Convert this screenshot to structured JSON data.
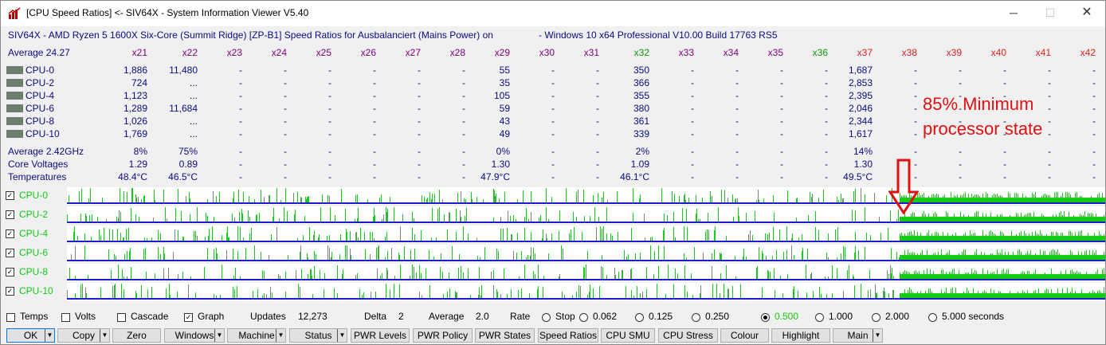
{
  "window": {
    "title": "[CPU Speed Ratios] <- SIV64X - System Information Viewer V5.40",
    "minimize_glyph": "─",
    "maximize_glyph": "☐",
    "close_glyph": "✕"
  },
  "header": {
    "system_line": "SIV64X - AMD Ryzen 5 1600X Six-Core (Summit Ridge) [ZP-B1] Speed Ratios for Ausbalanciert (Mains Power) on",
    "os_line": "- Windows 10 x64 Professional  V10.00  Build 17763  RS5"
  },
  "ratios": {
    "average_label": "Average 24.27",
    "columns": [
      {
        "label": "x21",
        "color": "purple"
      },
      {
        "label": "x22",
        "color": "purple"
      },
      {
        "label": "x23",
        "color": "purple"
      },
      {
        "label": "x24",
        "color": "purple"
      },
      {
        "label": "x25",
        "color": "purple"
      },
      {
        "label": "x26",
        "color": "purple"
      },
      {
        "label": "x27",
        "color": "purple"
      },
      {
        "label": "x28",
        "color": "purple"
      },
      {
        "label": "x29",
        "color": "purple"
      },
      {
        "label": "x30",
        "color": "purple"
      },
      {
        "label": "x31",
        "color": "purple"
      },
      {
        "label": "x32",
        "color": "green"
      },
      {
        "label": "x33",
        "color": "purple"
      },
      {
        "label": "x34",
        "color": "purple"
      },
      {
        "label": "x35",
        "color": "purple"
      },
      {
        "label": "x36",
        "color": "green"
      },
      {
        "label": "x37",
        "color": "red"
      },
      {
        "label": "x38",
        "color": "red"
      },
      {
        "label": "x39",
        "color": "red"
      },
      {
        "label": "x40",
        "color": "red"
      },
      {
        "label": "x41",
        "color": "red"
      },
      {
        "label": "x42",
        "color": "red"
      }
    ],
    "rows": [
      {
        "name": "CPU-0",
        "values": [
          "1,886",
          "11,480",
          "-",
          "-",
          "-",
          "-",
          "-",
          "-",
          "55",
          "-",
          "-",
          "350",
          "-",
          "-",
          "-",
          "-",
          "1,687",
          "-",
          "-",
          "-",
          "-",
          "-"
        ]
      },
      {
        "name": "CPU-2",
        "values": [
          "724",
          "...",
          "-",
          "-",
          "-",
          "-",
          "-",
          "-",
          "35",
          "-",
          "-",
          "366",
          "-",
          "-",
          "-",
          "-",
          "2,853",
          "-",
          "-",
          "-",
          "-",
          "-"
        ]
      },
      {
        "name": "CPU-4",
        "values": [
          "1,123",
          "...",
          "-",
          "-",
          "-",
          "-",
          "-",
          "-",
          "105",
          "-",
          "-",
          "355",
          "-",
          "-",
          "-",
          "-",
          "2,395",
          "-",
          "-",
          "-",
          "-",
          "-"
        ]
      },
      {
        "name": "CPU-6",
        "values": [
          "1,289",
          "11,684",
          "-",
          "-",
          "-",
          "-",
          "-",
          "-",
          "59",
          "-",
          "-",
          "380",
          "-",
          "-",
          "-",
          "-",
          "2,046",
          "-",
          "-",
          "-",
          "-",
          "-"
        ]
      },
      {
        "name": "CPU-8",
        "values": [
          "1,026",
          "...",
          "-",
          "-",
          "-",
          "-",
          "-",
          "-",
          "43",
          "-",
          "-",
          "361",
          "-",
          "-",
          "-",
          "-",
          "2,344",
          "-",
          "-",
          "-",
          "-",
          "-"
        ]
      },
      {
        "name": "CPU-10",
        "values": [
          "1,769",
          "...",
          "-",
          "-",
          "-",
          "-",
          "-",
          "-",
          "49",
          "-",
          "-",
          "339",
          "-",
          "-",
          "-",
          "-",
          "1,617",
          "-",
          "-",
          "-",
          "-",
          "-"
        ]
      }
    ],
    "summary": [
      {
        "name": "Average 2.42GHz",
        "values": [
          "8%",
          "75%",
          "-",
          "-",
          "-",
          "-",
          "-",
          "-",
          "0%",
          "-",
          "-",
          "2%",
          "-",
          "-",
          "-",
          "-",
          "14%",
          "-",
          "-",
          "-",
          "-",
          "-"
        ]
      },
      {
        "name": "Core Voltages",
        "values": [
          "1.29",
          "0.89",
          "-",
          "-",
          "-",
          "-",
          "-",
          "-",
          "1.30",
          "-",
          "-",
          "1.09",
          "-",
          "-",
          "-",
          "-",
          "1.30",
          "-",
          "-",
          "-",
          "-",
          "-"
        ]
      },
      {
        "name": "Temperatures",
        "values": [
          "48.4°C",
          "46.5°C",
          "-",
          "-",
          "-",
          "-",
          "-",
          "-",
          "47.9°C",
          "-",
          "-",
          "46.1°C",
          "-",
          "-",
          "-",
          "-",
          "49.5°C",
          "-",
          "-",
          "-",
          "-",
          "-"
        ]
      }
    ]
  },
  "graphs": [
    {
      "name": "CPU-0",
      "checked": true
    },
    {
      "name": "CPU-2",
      "checked": true
    },
    {
      "name": "CPU-4",
      "checked": true
    },
    {
      "name": "CPU-6",
      "checked": true
    },
    {
      "name": "CPU-8",
      "checked": true
    },
    {
      "name": "CPU-10",
      "checked": true
    }
  ],
  "annotation": {
    "line1": "85% Minimum",
    "line2": "processor state"
  },
  "status": {
    "temps_label": "Temps",
    "temps_checked": false,
    "volts_label": "Volts",
    "volts_checked": false,
    "cascade_label": "Cascade",
    "cascade_checked": false,
    "graph_label": "Graph",
    "graph_checked": true,
    "updates_label": "Updates",
    "updates_value": "12,273",
    "delta_label": "Delta",
    "delta_value": "2",
    "average_label": "Average",
    "average_value": "2.0",
    "rate_label": "Rate",
    "rates": [
      {
        "label": "Stop",
        "selected": false
      },
      {
        "label": "0.062",
        "selected": false
      },
      {
        "label": "0.125",
        "selected": false
      },
      {
        "label": "0.250",
        "selected": false
      },
      {
        "label": "0.500",
        "selected": true
      },
      {
        "label": "1.000",
        "selected": false
      },
      {
        "label": "2.000",
        "selected": false
      },
      {
        "label": "5.000 seconds",
        "selected": false
      }
    ]
  },
  "buttons": {
    "ok": "OK",
    "copy": "Copy",
    "zero": "Zero",
    "windows": "Windows",
    "machine": "Machine",
    "status": "Status",
    "pwr_levels": "PWR Levels",
    "pwr_policy": "PWR Policy",
    "pwr_states": "PWR States",
    "speed_ratios": "Speed Ratios",
    "cpu_smu": "CPU SMU",
    "cpu_stress": "CPU Stress",
    "colour": "Colour",
    "highlight": "Highlight",
    "main": "Main",
    "dropdown_glyph": "▼"
  },
  "colors": {
    "navy": "#0a0a80",
    "purple": "#800080",
    "green": "#0b9a0b",
    "red": "#e0201a",
    "graph_green": "#14cc14",
    "graph_baseline": "#1a1acc",
    "annotation": "#e01010"
  }
}
